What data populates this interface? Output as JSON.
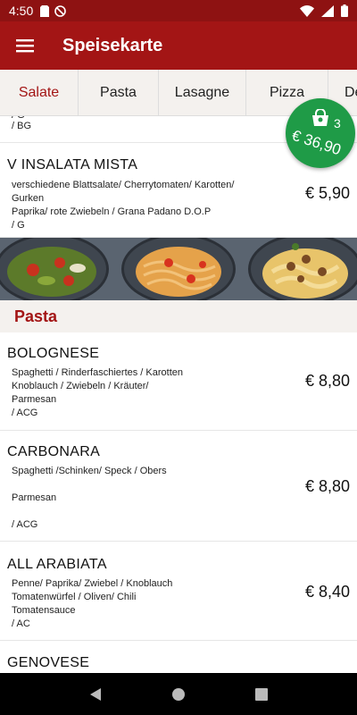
{
  "status_bar": {
    "time": "4:50"
  },
  "app_bar": {
    "title": "Speisekarte"
  },
  "tabs": [
    {
      "label": "Salate",
      "active": true
    },
    {
      "label": "Pasta"
    },
    {
      "label": "Lasagne"
    },
    {
      "label": "Pizza"
    },
    {
      "label": "De"
    }
  ],
  "partial_item": {
    "desc_top": "/ G",
    "desc": "/ BG"
  },
  "salate": [
    {
      "name": "V INSALATA MISTA",
      "desc": "verschiedene Blattsalate/ Cherrytomaten/  Karotten/ Gurken\n Paprika/ rote Zwiebeln / Grana Padano D.O.P\n/ G",
      "price": "€ 5,90"
    }
  ],
  "section": {
    "title": "Pasta"
  },
  "pasta": [
    {
      "name": "BOLOGNESE",
      "desc": "Spaghetti /  Rinderfaschiertes /  Karotten\n Knoblauch /  Zwiebeln / Kräuter/\nParmesan\n / ACG",
      "price": "€ 8,80"
    },
    {
      "name": "CARBONARA",
      "desc": "Spaghetti /Schinken/ Speck / Obers\n\nParmesan\n\n/ ACG",
      "price": "€ 8,80"
    },
    {
      "name": "ALL ARABIATA",
      "desc": "Penne/ Paprika/  Zwiebel /  Knoblauch\nTomatenwürfel /  Oliven/ Chili\nTomatensauce\n / AC",
      "price": "€ 8,40"
    },
    {
      "name": "GENOVESE"
    }
  ],
  "cart": {
    "count": "3",
    "total": "€ 36,90",
    "color": "#1f9b47"
  },
  "colors": {
    "primary": "#a31515",
    "status": "#8e1212",
    "section_bg": "#f4f1ee"
  }
}
